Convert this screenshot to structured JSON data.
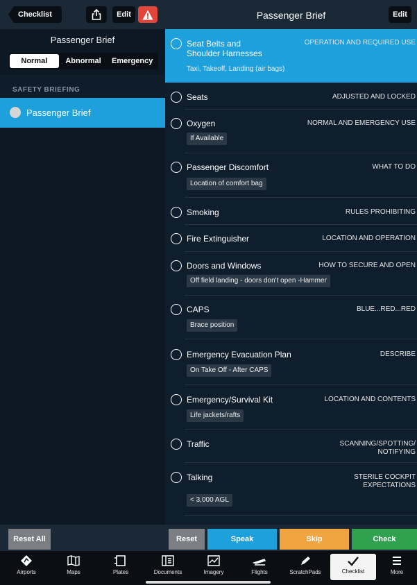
{
  "left": {
    "back_label": "Checklist",
    "edit_label": "Edit",
    "title": "Passenger Brief",
    "segments": [
      "Normal",
      "Abnormal",
      "Emergency"
    ],
    "section_label": "SAFETY BRIEFING",
    "selected_item": "Passenger Brief",
    "reset_all_label": "Reset All"
  },
  "right": {
    "title": "Passenger Brief",
    "edit_label": "Edit",
    "items": [
      {
        "item": "Seat Belts and\nShoulder Harnesses",
        "action": "OPERATION AND REQUIRED USE",
        "note": "Taxi, Takeoff, Landing (air bags)"
      },
      {
        "item": "Seats",
        "action": "ADJUSTED AND LOCKED",
        "note": ""
      },
      {
        "item": "Oxygen",
        "action": "NORMAL AND EMERGENCY USE",
        "note": "If Available"
      },
      {
        "item": "Passenger Discomfort",
        "action": "WHAT TO DO",
        "note": "Location of comfort bag"
      },
      {
        "item": "Smoking",
        "action": "RULES PROHIBITING",
        "note": ""
      },
      {
        "item": "Fire Extinguisher",
        "action": "LOCATION AND OPERATION",
        "note": ""
      },
      {
        "item": "Doors and Windows",
        "action": "HOW TO SECURE AND OPEN",
        "note": "Off field landing - doors don't open -Hammer"
      },
      {
        "item": "CAPS",
        "action": "BLUE...RED...RED",
        "note": "Brace position"
      },
      {
        "item": "Emergency Evacuation Plan",
        "action": "DESCRIBE",
        "note": "On Take Off - After CAPS"
      },
      {
        "item": "Emergency/Survival Kit",
        "action": "LOCATION AND CONTENTS",
        "note": "Life jackets/rafts"
      },
      {
        "item": "Traffic",
        "action": "SCANNING/SPOTTING/\nNOTIFYING",
        "note": ""
      },
      {
        "item": "Talking",
        "action": "STERILE COCKPIT\nEXPECTATIONS",
        "note": "< 3,000 AGL"
      }
    ],
    "buttons": {
      "reset": "Reset",
      "speak": "Speak",
      "skip": "Skip",
      "check": "Check"
    }
  },
  "tabs": [
    {
      "label": "Airports",
      "icon": "airports-icon"
    },
    {
      "label": "Maps",
      "icon": "maps-icon"
    },
    {
      "label": "Plates",
      "icon": "plates-icon"
    },
    {
      "label": "Documents",
      "icon": "documents-icon"
    },
    {
      "label": "Imagery",
      "icon": "imagery-icon"
    },
    {
      "label": "Flights",
      "icon": "flights-icon"
    },
    {
      "label": "ScratchPads",
      "icon": "scratchpads-icon"
    },
    {
      "label": "Checklist",
      "icon": "checklist-icon"
    },
    {
      "label": "More",
      "icon": "more-icon"
    }
  ],
  "colors": {
    "accent": "#1ea0dc",
    "skip": "#f0a540",
    "check": "#30a14e",
    "warning": "#e2453a"
  }
}
